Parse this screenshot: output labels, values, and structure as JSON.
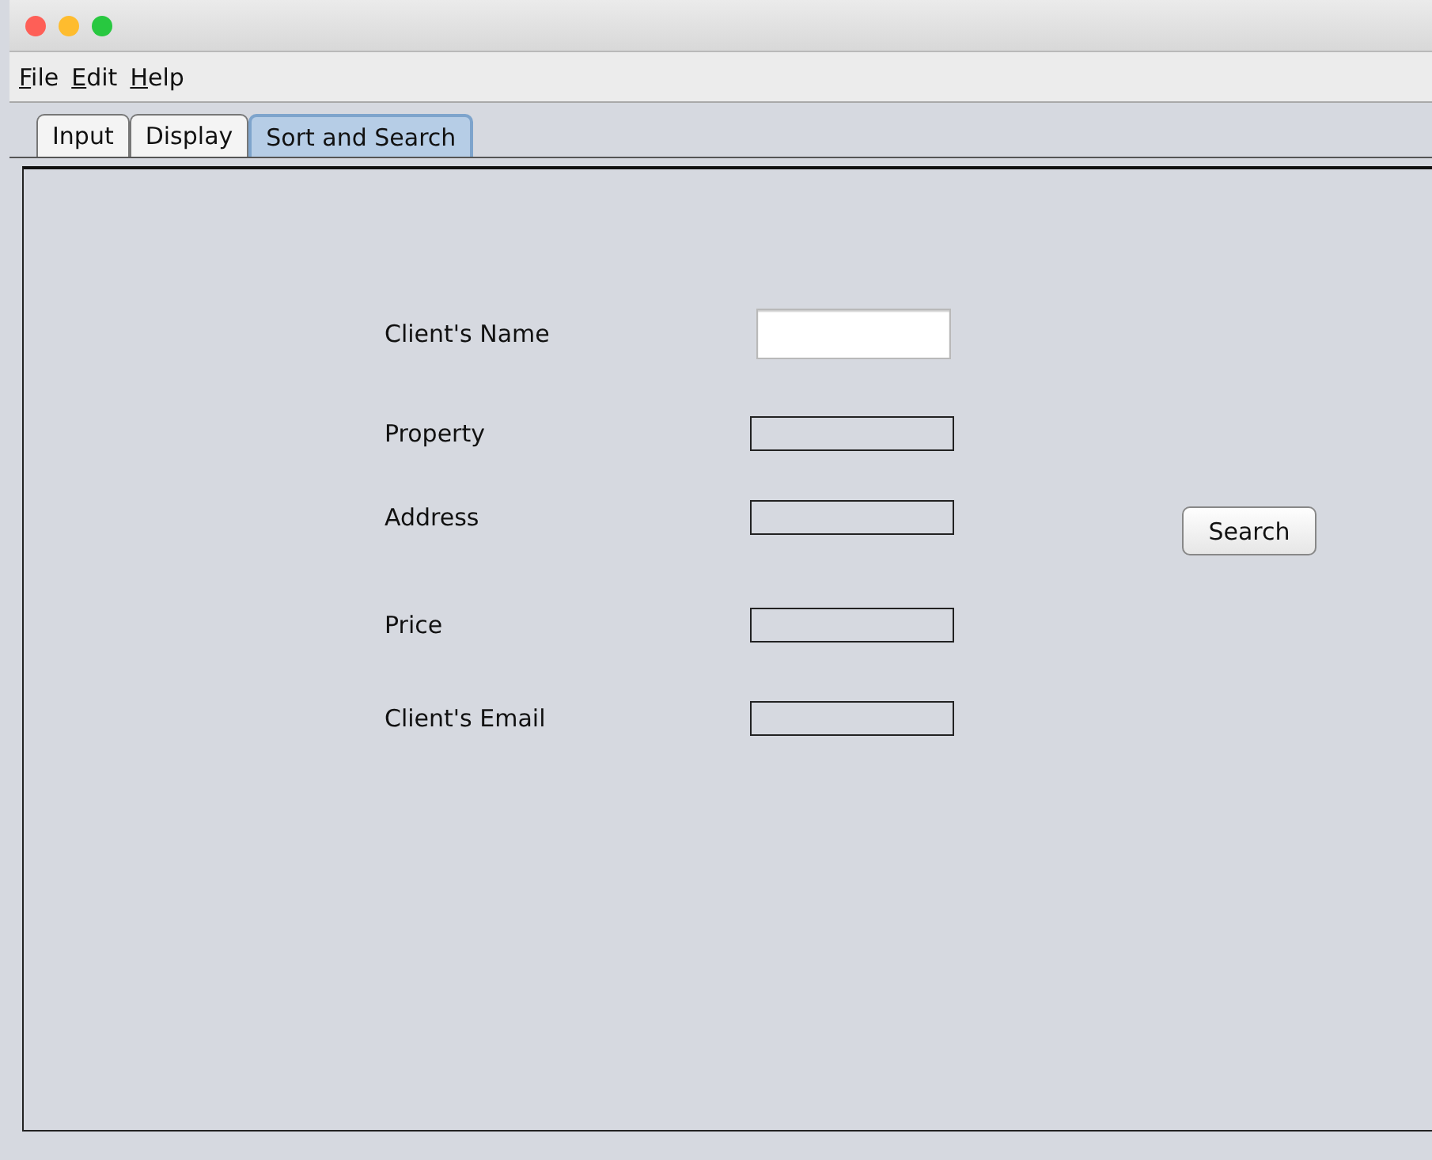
{
  "window": {
    "controls": [
      {
        "kind": "close"
      },
      {
        "kind": "minimize"
      },
      {
        "kind": "zoom"
      }
    ]
  },
  "menu": [
    "File",
    "Edit",
    "Help"
  ],
  "tabs": [
    {
      "label": "Input",
      "selected": false
    },
    {
      "label": "Display",
      "selected": false
    },
    {
      "label": "Sort and Search",
      "selected": true
    }
  ],
  "fields": [
    {
      "label": "Client's Name",
      "editable": true
    },
    {
      "label": "Property",
      "editable": false
    },
    {
      "label": "Address",
      "editable": false
    },
    {
      "label": "Price",
      "editable": false
    },
    {
      "label": "Client's Email",
      "editable": false
    }
  ],
  "buttons": [
    "Search"
  ]
}
